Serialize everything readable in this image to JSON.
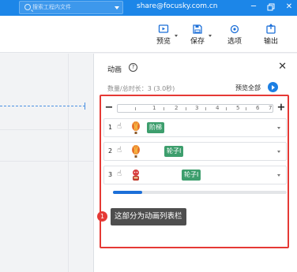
{
  "titlebar": {
    "search_placeholder": "搜索工程内文件",
    "user_email": "share@focusky.com.cn",
    "window_buttons": [
      "minimize",
      "restore",
      "close"
    ]
  },
  "toolbar": {
    "buttons": [
      {
        "label": "预览",
        "icon": "preview-icon"
      },
      {
        "label": "保存",
        "icon": "save-icon"
      },
      {
        "label": "选项",
        "icon": "options-icon"
      },
      {
        "label": "输出",
        "icon": "export-icon"
      }
    ]
  },
  "panel": {
    "title": "动画",
    "help_glyph": "?",
    "close_glyph": "✕",
    "count_text": "数量/总时长：3 (3.0秒)",
    "preview_all": "预览全部",
    "ruler": {
      "minus": "−",
      "plus": "+",
      "ticks": [
        "1",
        "2",
        "3",
        "4",
        "5",
        "6",
        "7"
      ]
    },
    "rows": [
      {
        "num": "1",
        "tag": "阶梯",
        "thumb": "hot-air-balloon-icon"
      },
      {
        "num": "2",
        "tag": "轮子I",
        "thumb": "hot-air-balloon-icon"
      },
      {
        "num": "3",
        "tag": "轮子I",
        "thumb": "cartoon-figure-icon"
      }
    ],
    "scroll_progress": 0.17
  },
  "callout": {
    "badge": "1",
    "text": "这部分为动画列表栏"
  },
  "colors": {
    "titlebar": "#1c86e8",
    "tag_green": "#3d9e6d",
    "highlight_red": "#e53935",
    "accent_blue": "#1c7fe3"
  }
}
